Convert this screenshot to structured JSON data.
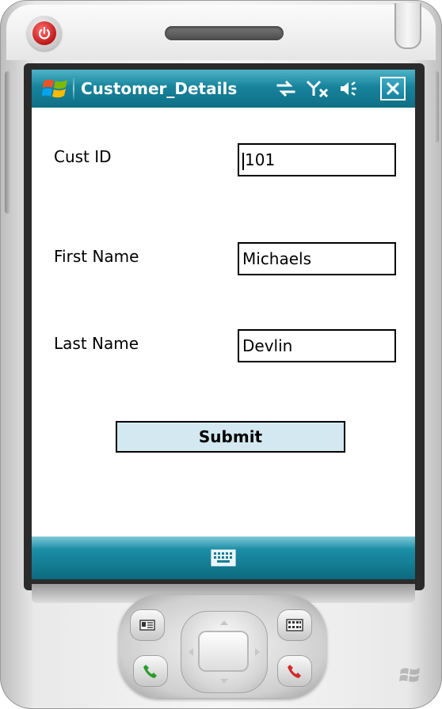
{
  "window": {
    "title": "Customer_Details",
    "accent_color": "#17849c"
  },
  "status_icons": [
    "sync-icon",
    "signal-off-icon",
    "volume-icon"
  ],
  "form": {
    "fields": [
      {
        "label": "Cust ID",
        "value": "101"
      },
      {
        "label": "First Name",
        "value": "Michaels"
      },
      {
        "label": "Last Name",
        "value": "Devlin"
      }
    ],
    "submit_label": "Submit"
  },
  "softbar": {
    "center_icon": "keyboard-icon"
  },
  "hardware": {
    "power_icon": "power-icon",
    "left_icon": "contact-card-icon",
    "right_icon": "calendar-icon",
    "call_icon": "phone-call-icon",
    "end_icon": "phone-end-icon"
  }
}
